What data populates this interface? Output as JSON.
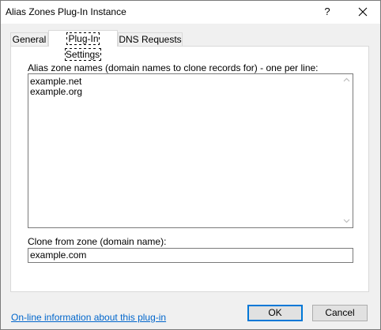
{
  "window": {
    "title": "Alias Zones Plug-In Instance",
    "help_label": "?",
    "close_label": "✕"
  },
  "tabs": [
    {
      "label": "General"
    },
    {
      "label": "Plug-In Settings",
      "active": true
    },
    {
      "label": "DNS Requests"
    }
  ],
  "settings": {
    "alias_label": "Alias zone names (domain names to clone records for) - one per line:",
    "alias_lines": [
      "example.net",
      "example.org"
    ],
    "clone_label": "Clone from zone (domain name):",
    "clone_value": "example.com"
  },
  "footer": {
    "info_link": "On-line information about this plug-in",
    "ok_label": "OK",
    "cancel_label": "Cancel"
  },
  "colors": {
    "link": "#0066cc",
    "default_button_border": "#0078d7"
  }
}
